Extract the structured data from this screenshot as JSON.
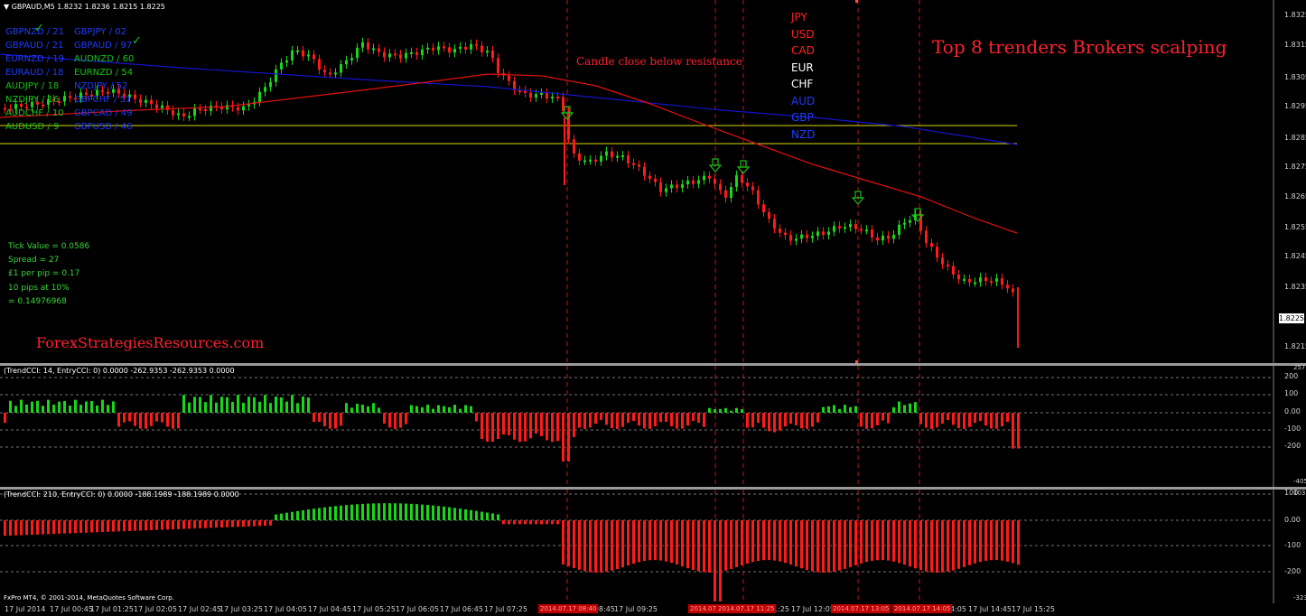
{
  "main_chart": {
    "header": "GBPAUD,M5  1.8232 1.8236 1.8215 1.8225",
    "headline": "Top 8 trenders Brokers scalping",
    "annotation": "Candle close below resistance",
    "watermark": "ForexStrategiesResources.com",
    "current_price": "1.8225",
    "price_ticks": [
      "1.8325",
      "1.8315",
      "1.8305",
      "1.8295",
      "1.8285",
      "1.8275",
      "1.8265",
      "1.8255",
      "1.8245",
      "1.8235",
      "1.8215"
    ],
    "strength_left": [
      {
        "label": "GBPNZD / 21",
        "color": "#1e3cff",
        "check": true
      },
      {
        "label": "GBPAUD / 21",
        "color": "#1e3cff",
        "check": false
      },
      {
        "label": "EURNZD / 19",
        "color": "#1e3cff",
        "check": false
      },
      {
        "label": "EURAUD / 18",
        "color": "#1e3cff",
        "check": false
      },
      {
        "label": "AUDJPY / 18",
        "color": "#18c218",
        "check": false
      },
      {
        "label": "NZDJPY / 16",
        "color": "#18c218",
        "check": false
      },
      {
        "label": "AUDCHF / 10",
        "color": "#18c218",
        "check": false
      },
      {
        "label": "AUDUSD / 9",
        "color": "#18c218",
        "check": false
      }
    ],
    "strength_right": [
      {
        "label": "GBPJPY / 02",
        "color": "#1e3cff",
        "check": false
      },
      {
        "label": "GBPAUD / 97",
        "color": "#1e3cff",
        "check": true
      },
      {
        "label": "AUDNZD / 60",
        "color": "#18c218",
        "check": false
      },
      {
        "label": "EURNZD / 54",
        "color": "#18c218",
        "check": false
      },
      {
        "label": "NZDJPY / 52",
        "color": "#1e3cff",
        "check": false
      },
      {
        "label": "GBPCHF / 51",
        "color": "#1e3cff",
        "check": false
      },
      {
        "label": "GBPCAD / 49",
        "color": "#1e3cff",
        "check": false
      },
      {
        "label": "GBPUSD / 46",
        "color": "#1e3cff",
        "check": false
      }
    ],
    "currencies": [
      {
        "name": "JPY",
        "color": "#ff2020"
      },
      {
        "name": "USD",
        "color": "#ff2020"
      },
      {
        "name": "CAD",
        "color": "#ff2020"
      },
      {
        "name": "EUR",
        "color": "#ffffff"
      },
      {
        "name": "CHF",
        "color": "#ffffff"
      },
      {
        "name": "AUD",
        "color": "#1e3cff"
      },
      {
        "name": "GBP",
        "color": "#1e3cff"
      },
      {
        "name": "NZD",
        "color": "#1e3cff"
      }
    ],
    "info": {
      "tick_value": "Tick Value = 0.0586",
      "spread": "Spread = 27",
      "per_pip": "£1 per pip = 0.17",
      "pips": "10 pips at 10%",
      "result": "= 0.14976968"
    }
  },
  "indicator1": {
    "header": "(TrendCCI: 14, EntryCCI: 0)  0.0000 -262.9353 -262.9353 0.0000",
    "ticks": [
      "257.2386",
      "200",
      "100",
      "0.00",
      "-100",
      "-200",
      "-405.768"
    ]
  },
  "indicator2": {
    "header": "(TrendCCI: 210, EntryCCI: 0)  0.0000 -188.1989 -188.1989 0.0000",
    "ticks": [
      "103.0065",
      "100",
      "0.00",
      "-100",
      "-200",
      "-323.225"
    ]
  },
  "time_axis": {
    "labels": [
      "17 Jul 2014",
      "17 Jul 00:45",
      "17 Jul 01:25",
      "17 Jul 02:05",
      "17 Jul 02:45",
      "17 Jul 03:25",
      "17 Jul 04:05",
      "17 Jul 04:45",
      "17 Jul 05:25",
      "17 Jul 06:05",
      "17 Jul 06:45",
      "17 Jul 07:25",
      "17 Jul 08:45",
      "17 Jul 09:25",
      "17 Jul 11:25",
      "17 Jul 12:05",
      "17 Jul 14:05",
      "17 Jul 14:45",
      "17 Jul 15:25"
    ],
    "highlights": [
      "2014.07.17 08:40",
      "2014.07.17 10:55",
      "2014.07.17 11:25",
      "2014.07.17 13:05",
      "2014.07.17 14:05"
    ]
  },
  "footer": "FxPro MT4, © 2001-2014, MetaQuotes Software Corp.",
  "colors": {
    "bull": "#18d618",
    "bear": "#ff1a1a",
    "ma_red": "#e01010",
    "ma_blue": "#1414c8",
    "hline": "#d8d800"
  }
}
